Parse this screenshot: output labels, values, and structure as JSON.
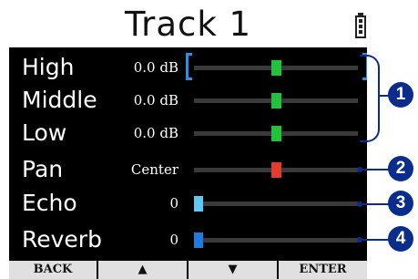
{
  "header": {
    "title": "Track 1",
    "battery_icon": "battery-full-icon"
  },
  "rows": [
    {
      "id": "high",
      "label": "High",
      "value": "0.0 dB",
      "level": 0.5,
      "kind": "knob",
      "color": "#22c33b"
    },
    {
      "id": "middle",
      "label": "Middle",
      "value": "0.0 dB",
      "level": 0.5,
      "kind": "knob",
      "color": "#22c33b"
    },
    {
      "id": "low",
      "label": "Low",
      "value": "0.0 dB",
      "level": 0.5,
      "kind": "knob",
      "color": "#22c33b"
    },
    {
      "id": "pan",
      "label": "Pan",
      "value": "Center",
      "level": 0.5,
      "kind": "knob",
      "color": "#e53a2e"
    },
    {
      "id": "echo",
      "label": "Echo",
      "value": "0",
      "level": 0.0,
      "kind": "bar",
      "color": "#5fc9f5"
    },
    {
      "id": "reverb",
      "label": "Reverb",
      "value": "0",
      "level": 0.0,
      "kind": "bar",
      "color": "#1e7be0"
    }
  ],
  "footer": {
    "back": "BACK",
    "up": "▲",
    "down": "▼",
    "enter": "ENTER"
  },
  "callouts": [
    "1",
    "2",
    "3",
    "4"
  ],
  "colors": {
    "selection": "#2b8fe6",
    "callout": "#0a2d8c"
  }
}
